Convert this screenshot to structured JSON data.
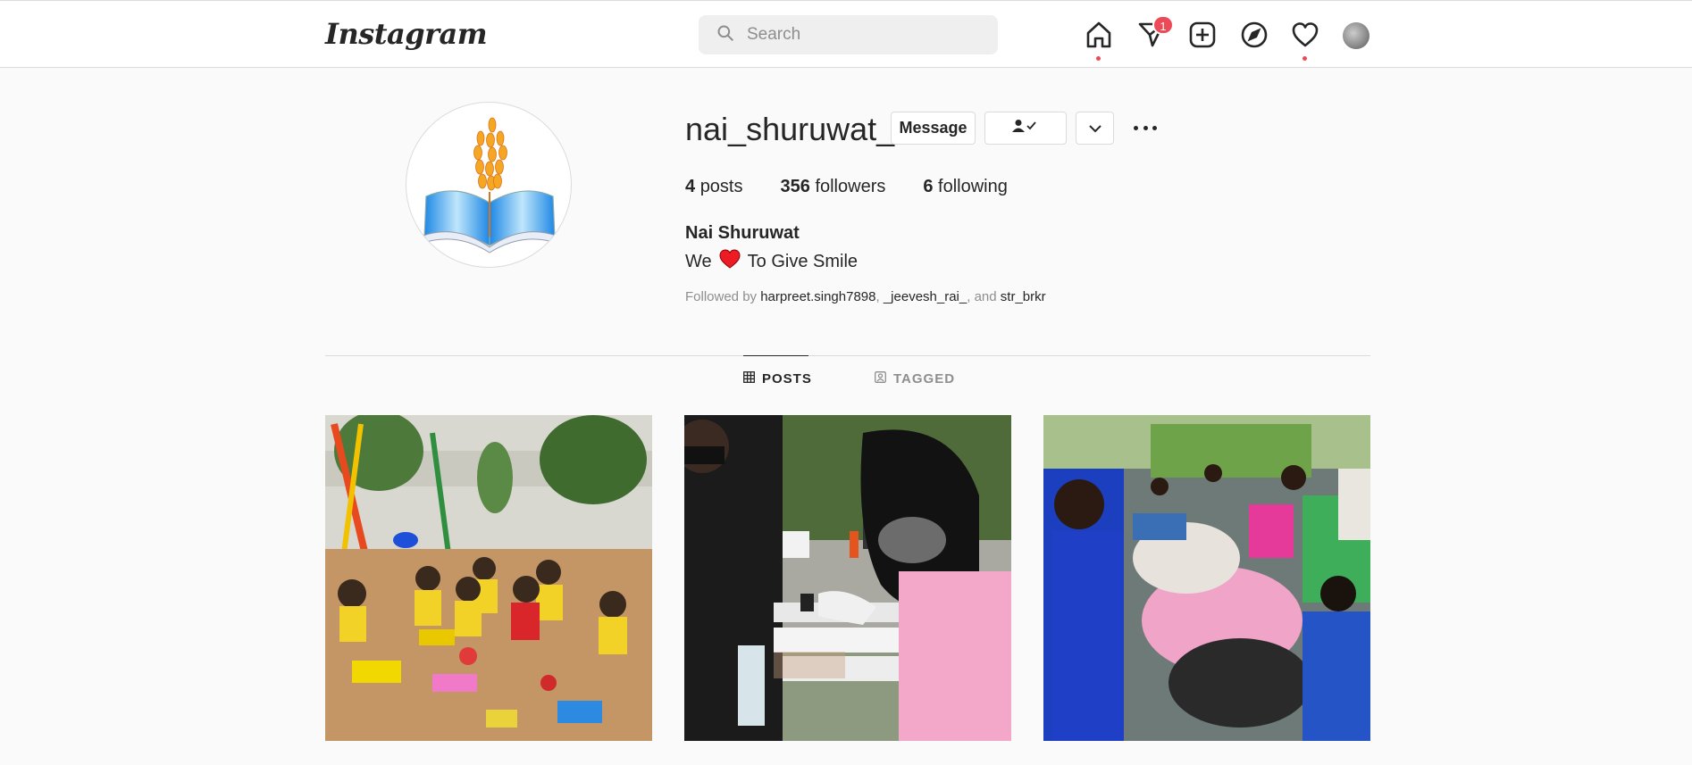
{
  "header": {
    "logo_text": "Instagram",
    "search_placeholder": "Search",
    "nav_icons": [
      "home-icon",
      "direct-icon",
      "new-post-icon",
      "explore-icon",
      "activity-icon",
      "avatar"
    ],
    "direct_badge": "1"
  },
  "profile": {
    "username": "nai_shuruwat_",
    "message_label": "Message",
    "stats": {
      "posts_count": "4",
      "posts_label": "posts",
      "followers_count": "356",
      "followers_label": "followers",
      "following_count": "6",
      "following_label": "following"
    },
    "full_name": "Nai Shuruwat",
    "bio_prefix": "We",
    "bio_suffix": "To Give Smile",
    "followed_by_label": "Followed by",
    "followed_by_users": [
      "harpreet.singh7898",
      "_jeevesh_rai_",
      "str_brkr"
    ],
    "followed_sep1": ",",
    "followed_sep2": ", and"
  },
  "tabs": {
    "posts_label": "POSTS",
    "tagged_label": "TAGGED"
  },
  "posts": [
    {
      "alt": "Children playing in a sandpit"
    },
    {
      "alt": "Food being handed to a child"
    },
    {
      "alt": "Clothes distribution drive"
    }
  ],
  "colors": {
    "badge": "#ed4956",
    "heart": "#ed1c24",
    "text": "#262626",
    "muted": "#8e8e8e"
  }
}
